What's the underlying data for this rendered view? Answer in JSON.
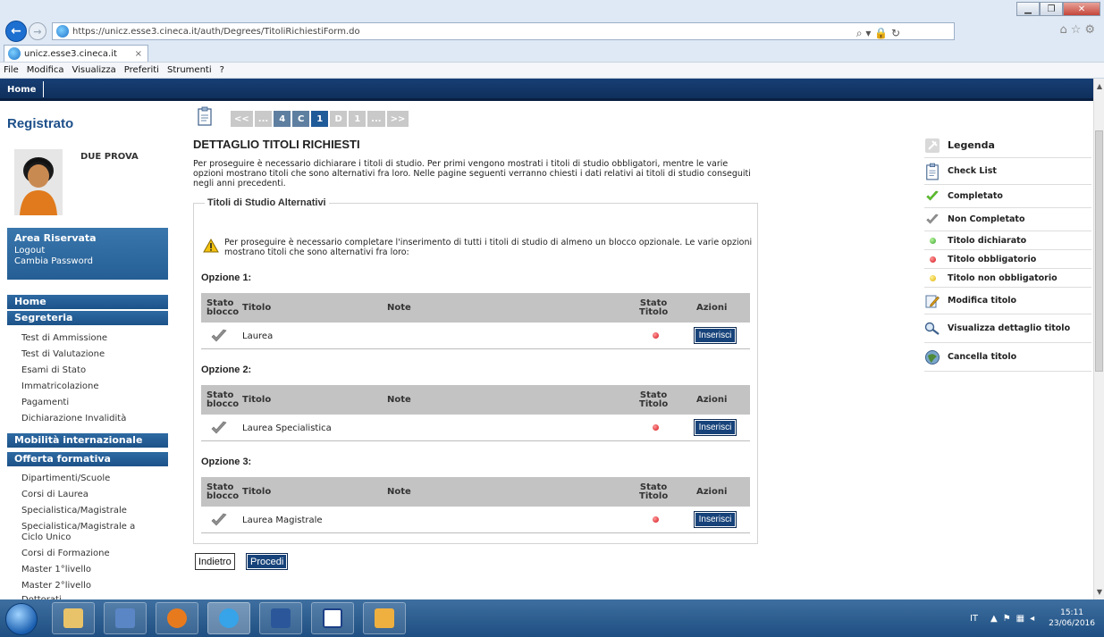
{
  "browser": {
    "url": "https://unicz.esse3.cineca.it/auth/Degrees/TitoliRichiestiForm.do",
    "tab_title": "unicz.esse3.cineca.it",
    "tab_close": "×",
    "menu": [
      "File",
      "Modifica",
      "Visualizza",
      "Preferiti",
      "Strumenti",
      "?"
    ],
    "address_tools": "⌕ ▾ 🔒 ↻"
  },
  "site": {
    "home_tab": "Home"
  },
  "sidebar": {
    "title": "Registrato",
    "user_name": "DUE PROVA",
    "area": {
      "title": "Area Riservata",
      "links": [
        "Logout",
        "Cambia Password"
      ]
    },
    "home": "Home",
    "segreteria": {
      "title": "Segreteria",
      "links": [
        "Test di Ammissione",
        "Test di Valutazione",
        "Esami di Stato",
        "Immatricolazione",
        "Pagamenti",
        "Dichiarazione Invalidità"
      ]
    },
    "mobilita": "Mobilità internazionale",
    "offerta": {
      "title": "Offerta formativa",
      "links": [
        "Dipartimenti/Scuole",
        "Corsi di Laurea",
        "Specialistica/Magistrale",
        "Specialistica/Magistrale a Ciclo Unico",
        "Corsi di Formazione",
        "Master 1°livello",
        "Master 2°livello",
        "Dottorati"
      ]
    }
  },
  "pager": [
    "<<",
    "...",
    "4",
    "C",
    "1",
    "D",
    "1",
    "...",
    ">>"
  ],
  "main": {
    "title": "DETTAGLIO TITOLI RICHIESTI",
    "intro": "Per proseguire è necessario dichiarare i titoli di studio. Per primi vengono mostrati i titoli di studio obbligatori, mentre le varie opzioni mostrano titoli che sono alternativi fra loro. Nelle pagine seguenti verranno chiesti i dati relativi ai titoli di studio conseguiti negli anni precedenti.",
    "fieldset_title": "Titoli di Studio Alternativi",
    "warning": "Per proseguire è necessario completare l'inserimento di tutti i titoli di studio di almeno un blocco opzionale. Le varie opzioni mostrano titoli che sono alternativi fra loro:",
    "columns": {
      "stato_blocco_1": "Stato",
      "stato_blocco_2": "blocco",
      "titolo": "Titolo",
      "note": "Note",
      "stato_titolo_1": "Stato",
      "stato_titolo_2": "Titolo",
      "azioni": "Azioni"
    },
    "options": [
      {
        "label": "Opzione 1:",
        "title": "Laurea",
        "button": "Inserisci"
      },
      {
        "label": "Opzione 2:",
        "title": "Laurea Specialistica",
        "button": "Inserisci"
      },
      {
        "label": "Opzione 3:",
        "title": "Laurea Magistrale",
        "button": "Inserisci"
      }
    ],
    "back_button": "Indietro",
    "next_button": "Procedi"
  },
  "legend": {
    "title": "Legenda",
    "items": [
      {
        "label": "Check List",
        "icon": "checklist-icon"
      },
      {
        "label": "Completato",
        "icon": "green-check-icon"
      },
      {
        "label": "Non Completato",
        "icon": "grey-check-icon"
      },
      {
        "label": "Titolo dichiarato",
        "icon": "green-dot-icon"
      },
      {
        "label": "Titolo obbligatorio",
        "icon": "red-dot-icon"
      },
      {
        "label": "Titolo non obbligatorio",
        "icon": "yellow-dot-icon"
      },
      {
        "label": "Modifica titolo",
        "icon": "edit-icon"
      },
      {
        "label": "Visualizza dettaglio titolo",
        "icon": "magnifier-icon"
      },
      {
        "label": "Cancella titolo",
        "icon": "delete-icon"
      }
    ]
  },
  "taskbar": {
    "language": "IT",
    "time": "15:11",
    "date": "23/06/2016"
  },
  "colors": {
    "header_navy": "#173f75",
    "nav_blue": "#1c5288",
    "button_navy": "#17437a",
    "required_red": "#d4141c",
    "declared_green": "#3aa534",
    "optional_yellow": "#e0b000"
  }
}
